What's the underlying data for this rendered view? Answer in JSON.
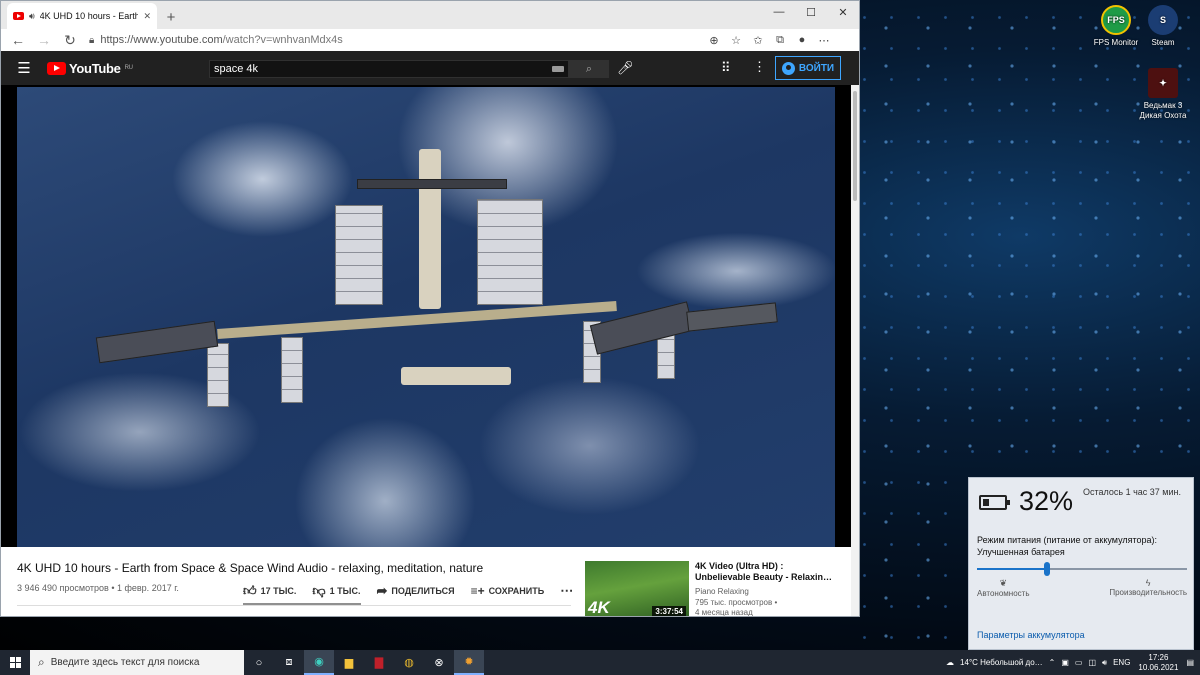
{
  "desktop": {
    "icons": [
      {
        "label": "FPS Monitor",
        "glyph": "FPS",
        "color": "#1e9b46"
      },
      {
        "label": "Steam",
        "glyph": "S",
        "color": "#1b3d73"
      },
      {
        "label": "Ведьмак 3 Дикая Охота",
        "glyph": "✦",
        "color": "#4d1010"
      }
    ]
  },
  "browser": {
    "tab_title": "4K UHD 10 hours - Earth fr",
    "url_host": "https://www.youtube.com",
    "url_path": "/watch?v=wnhvanMdx4s",
    "window_controls": [
      "—",
      "☐",
      "✕"
    ]
  },
  "youtube": {
    "logo": "YouTube",
    "region": "RU",
    "search_value": "space 4k",
    "signin_label": "ВОЙТИ",
    "video": {
      "title": "4K UHD 10 hours - Earth from Space & Space Wind Audio - relaxing, meditation, nature",
      "meta": "3 946 490 просмотров • 1 февр. 2017 г.",
      "likes": "17 ТЫС.",
      "dislikes": "1 ТЫС.",
      "share": "ПОДЕЛИТЬСЯ",
      "save": "СОХРАНИТЬ"
    },
    "recommended": {
      "title": "4K Video (Ultra HD) : Unbelievable Beauty - Relaxin…",
      "channel": "Piano Relaxing",
      "views": "795 тыс. просмотров •",
      "age": "4 месяца назад",
      "duration": "3:37:54",
      "badge": "4K"
    }
  },
  "battery": {
    "percent": "32%",
    "remaining": "Осталось 1 час 37 мин.",
    "mode": "Режим питания (питание от аккумулятора): Улучшенная батарея",
    "left_label": "Автономность",
    "right_label": "Производительность",
    "settings_link": "Параметры аккумулятора"
  },
  "taskbar": {
    "search_placeholder": "Введите здесь текст для поиска",
    "weather": "14°C  Небольшой до…",
    "lang": "ENG",
    "time": "17:26",
    "date": "10.06.2021"
  }
}
